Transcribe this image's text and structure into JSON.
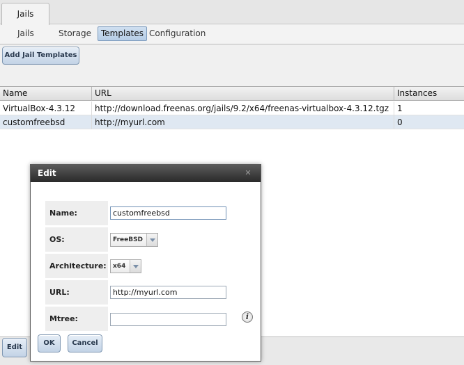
{
  "header": {
    "tab": "Jails"
  },
  "subnav": {
    "items": [
      "Jails",
      "Storage",
      "Templates",
      "Configuration"
    ],
    "active": "Templates"
  },
  "toolbar": {
    "add_label": "Add Jail Templates"
  },
  "table": {
    "columns": [
      "Name",
      "URL",
      "Instances"
    ],
    "rows": [
      {
        "name": "VirtualBox-4.3.12",
        "url": "http://download.freenas.org/jails/9.2/x64/freenas-virtualbox-4.3.12.tgz",
        "instances": "1"
      },
      {
        "name": "customfreebsd",
        "url": "http://myurl.com",
        "instances": "0"
      }
    ],
    "selected_row": 1
  },
  "bottom": {
    "edit_label": "Edit"
  },
  "dialog": {
    "title": "Edit",
    "fields": {
      "name_label": "Name:",
      "name_value": "customfreebsd",
      "os_label": "OS:",
      "os_value": "FreeBSD",
      "arch_label": "Architecture:",
      "arch_value": "x64",
      "url_label": "URL:",
      "url_value": "http://myurl.com",
      "mtree_label": "Mtree:",
      "mtree_value": ""
    },
    "ok_label": "OK",
    "cancel_label": "Cancel"
  },
  "icons": {
    "close": "close-icon",
    "info": "info-icon",
    "dropdown": "chevron-down-icon"
  },
  "colors": {
    "accent": "#b6cde6",
    "selected_row": "#dfe8f2",
    "dialog_titlebar": "#2a2a2a"
  }
}
